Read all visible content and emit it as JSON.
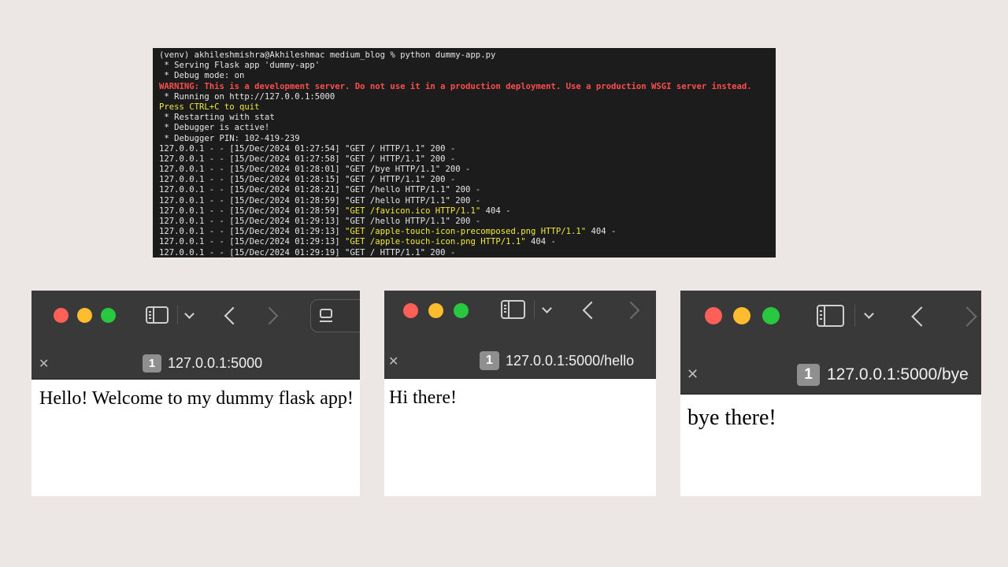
{
  "terminal": {
    "lines": [
      {
        "text": "(venv) akhileshmishra@Akhileshmac medium_blog % python dummy-app.py",
        "color": "#e6e6e6"
      },
      {
        "text": " * Serving Flask app 'dummy-app'",
        "color": "#e6e6e6"
      },
      {
        "text": " * Debug mode: on",
        "color": "#e6e6e6"
      },
      {
        "text": "WARNING: This is a development server. Do not use it in a production deployment. Use a production WSGI server instead.",
        "color": "#ff4d4d"
      },
      {
        "text": " * Running on http://127.0.0.1:5000",
        "color": "#e6e6e6"
      },
      {
        "text": "Press CTRL+C to quit",
        "color": "#f2ea3a"
      },
      {
        "text": " * Restarting with stat",
        "color": "#e6e6e6"
      },
      {
        "text": " * Debugger is active!",
        "color": "#e6e6e6"
      },
      {
        "text": " * Debugger PIN: 102-419-239",
        "color": "#e6e6e6"
      },
      {
        "text": "127.0.0.1 - - [15/Dec/2024 01:27:54] \"GET / HTTP/1.1\" 200 -",
        "color": "#e6e6e6"
      },
      {
        "text": "127.0.0.1 - - [15/Dec/2024 01:27:58] \"GET / HTTP/1.1\" 200 -",
        "color": "#e6e6e6"
      },
      {
        "text": "127.0.0.1 - - [15/Dec/2024 01:28:01] \"GET /bye HTTP/1.1\" 200 -",
        "color": "#e6e6e6"
      },
      {
        "text": "127.0.0.1 - - [15/Dec/2024 01:28:15] \"GET / HTTP/1.1\" 200 -",
        "color": "#e6e6e6"
      },
      {
        "text": "127.0.0.1 - - [15/Dec/2024 01:28:21] \"GET /hello HTTP/1.1\" 200 -",
        "color": "#e6e6e6"
      },
      {
        "text": "127.0.0.1 - - [15/Dec/2024 01:28:59] \"GET /hello HTTP/1.1\" 200 -",
        "color": "#e6e6e6"
      },
      {
        "prefix": "127.0.0.1 - - [15/Dec/2024 01:28:59] ",
        "highlight": "\"GET /favicon.ico HTTP/1.1\"",
        "suffix": " 404 -",
        "color": "#e6e6e6",
        "highlight_color": "#f2ea3a"
      },
      {
        "text": "127.0.0.1 - - [15/Dec/2024 01:29:13] \"GET /hello HTTP/1.1\" 200 -",
        "color": "#e6e6e6"
      },
      {
        "prefix": "127.0.0.1 - - [15/Dec/2024 01:29:13] ",
        "highlight": "\"GET /apple-touch-icon-precomposed.png HTTP/1.1\"",
        "suffix": " 404 -",
        "color": "#e6e6e6",
        "highlight_color": "#f2ea3a"
      },
      {
        "prefix": "127.0.0.1 - - [15/Dec/2024 01:29:13] ",
        "highlight": "\"GET /apple-touch-icon.png HTTP/1.1\"",
        "suffix": " 404 -",
        "color": "#e6e6e6",
        "highlight_color": "#f2ea3a"
      },
      {
        "text": "127.0.0.1 - - [15/Dec/2024 01:29:19] \"GET / HTTP/1.1\" 200 -",
        "color": "#e6e6e6"
      }
    ]
  },
  "windows": [
    {
      "tab_number": "1",
      "url": "127.0.0.1:5000",
      "content": "Hello! Welcome to my dummy flask app!"
    },
    {
      "tab_number": "1",
      "url": "127.0.0.1:5000/hello",
      "content": "Hi there!"
    },
    {
      "tab_number": "1",
      "url": "127.0.0.1:5000/bye",
      "content": "bye there!"
    }
  ],
  "icons": {
    "close": "close-icon",
    "sidebar": "sidebar-toggle-icon",
    "chevron": "chevron-down-icon",
    "back": "back-arrow-icon",
    "forward": "forward-arrow-icon",
    "reader": "reader-icon"
  },
  "glyphs": {
    "close": "✕"
  },
  "colors": {
    "background": "#ece6e5",
    "terminal_bg": "#1c1c1c",
    "terminal_text": "#e6e6e6",
    "terminal_warning": "#ff4d4d",
    "terminal_highlight": "#f2ea3a",
    "toolbar_bg": "#393939",
    "traffic_red": "#fe5f57",
    "traffic_yellow": "#febc2e",
    "traffic_green": "#28c840"
  }
}
